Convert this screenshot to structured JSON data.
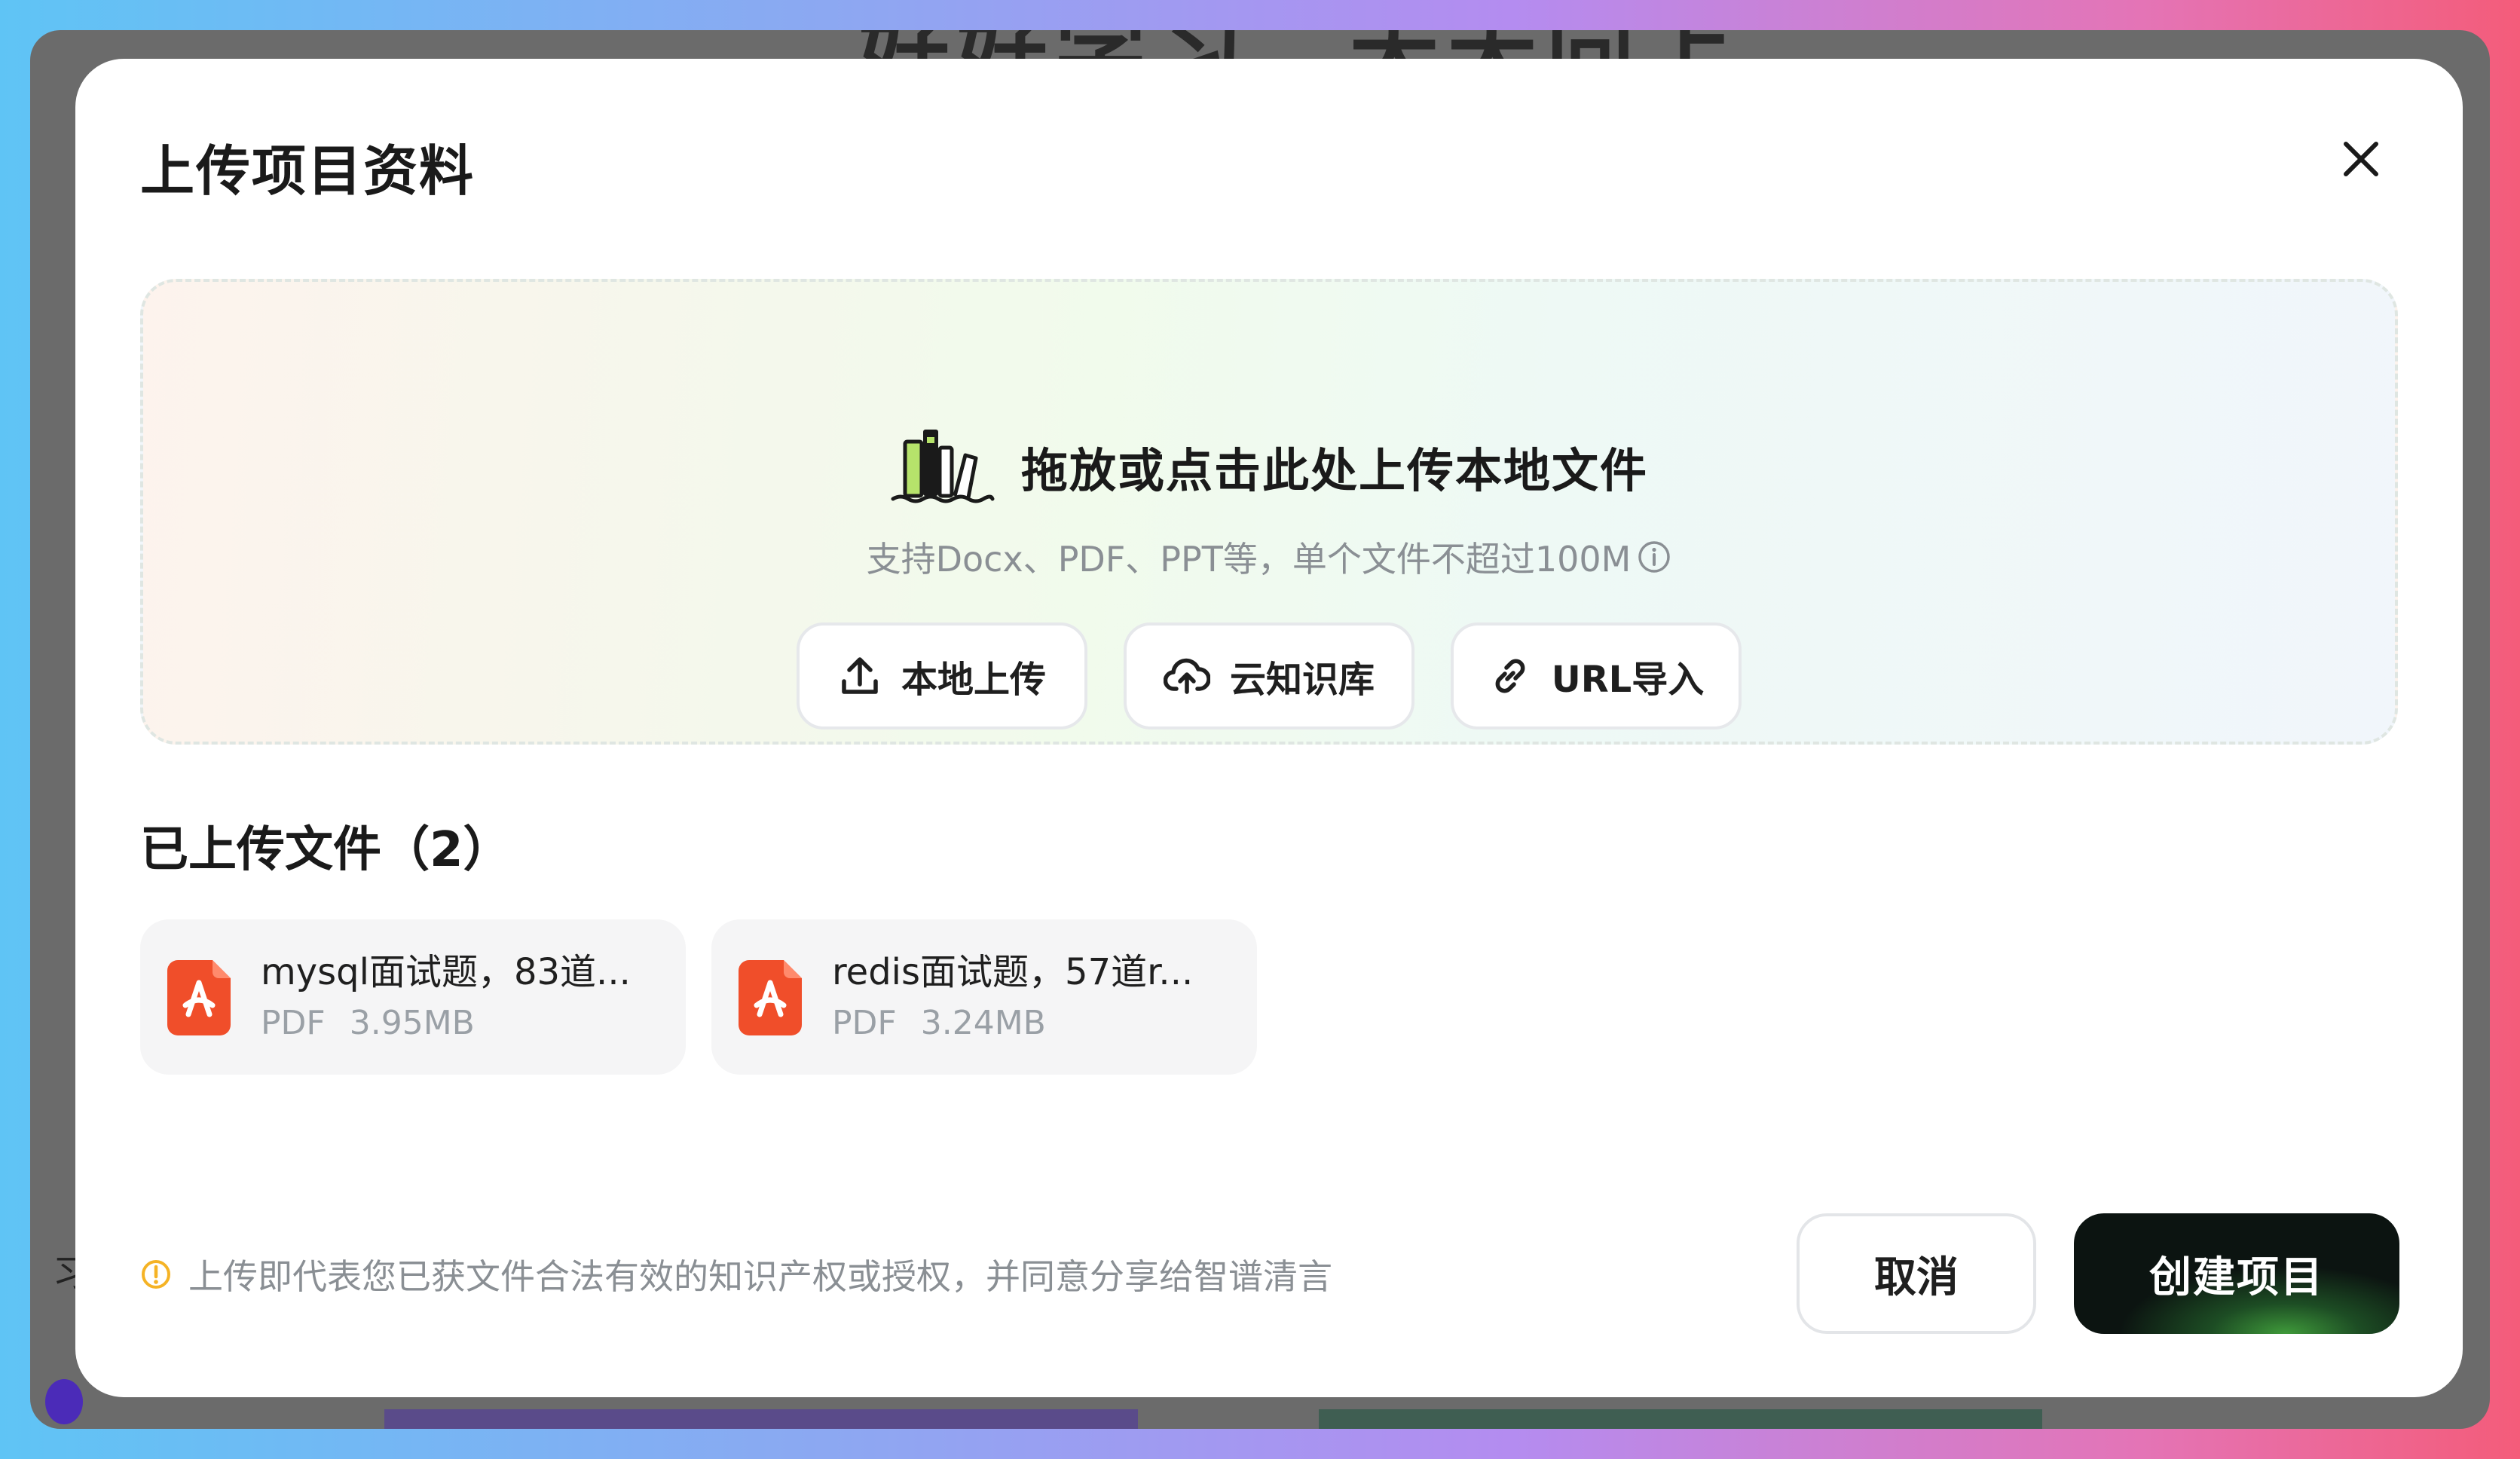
{
  "background": {
    "heading": "好好学习，天天向上",
    "side_text": "习."
  },
  "modal": {
    "title": "上传项目资料",
    "close_label": "×"
  },
  "dropzone": {
    "title": "拖放或点击此处上传本地文件",
    "subtitle": "支持Docx、PDF、PPT等，单个文件不超过100M",
    "buttons": [
      {
        "label": "本地上传",
        "icon": "upload-icon"
      },
      {
        "label": "云知识库",
        "icon": "cloud-upload-icon"
      },
      {
        "label": "URL导入",
        "icon": "link-icon"
      }
    ]
  },
  "uploaded": {
    "title": "已上传文件（2）",
    "files": [
      {
        "name": "mysql面试题，83道...",
        "type": "PDF",
        "size": "3.95MB"
      },
      {
        "name": "redis面试题，57道r...",
        "type": "PDF",
        "size": "3.24MB"
      }
    ]
  },
  "footer": {
    "note": "上传即代表您已获文件合法有效的知识产权或授权，并同意分享给智谱清言",
    "cancel_label": "取消",
    "create_label": "创建项目"
  },
  "colors": {
    "accent_dark": "#0c1411",
    "accent_green": "#3f9a3a",
    "pdf_red": "#f04e2a",
    "warning": "#f5b325"
  }
}
